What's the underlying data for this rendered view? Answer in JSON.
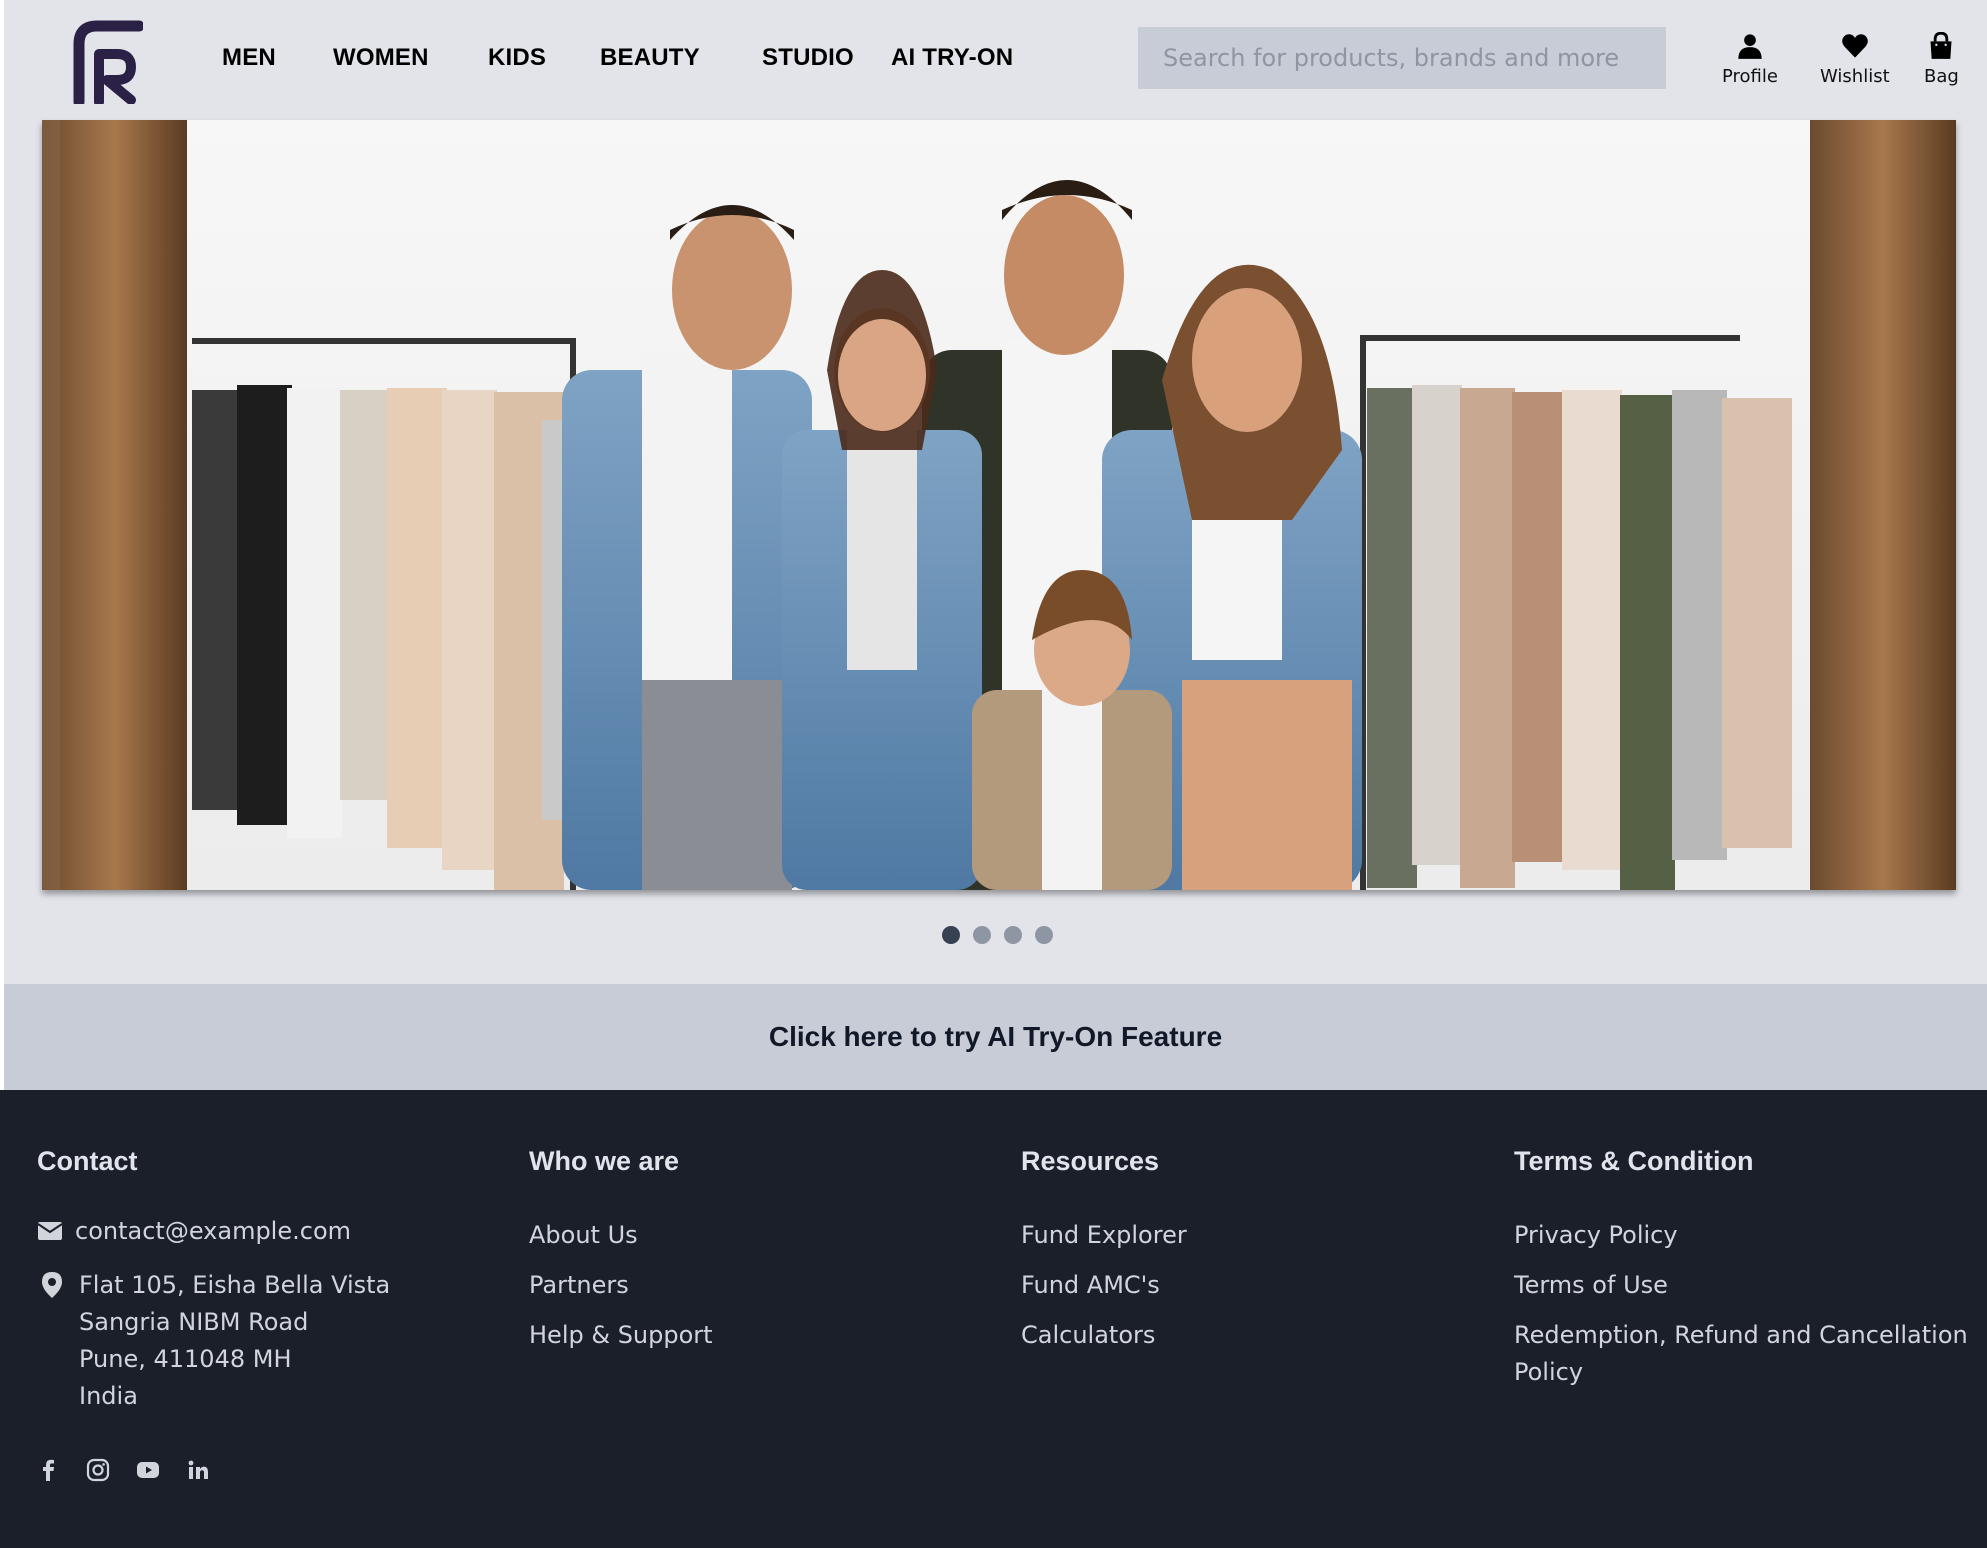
{
  "header": {
    "nav": [
      "MEN",
      "WOMEN",
      "KIDS",
      "BEAUTY",
      "STUDIO",
      "AI TRY-ON"
    ],
    "search_placeholder": "Search for products, brands and more",
    "icons": {
      "profile": "Profile",
      "wishlist": "Wishlist",
      "bag": "Bag"
    }
  },
  "hero": {
    "image": "hero-family-denim-photo",
    "slides": 4,
    "active_slide": 1
  },
  "cta": {
    "label": "Click here to try AI Try-On Feature"
  },
  "footer": {
    "contact": {
      "heading": "Contact",
      "email": "contact@example.com",
      "address": [
        "Flat 105, Eisha Bella Vista",
        "Sangria NIBM Road",
        "Pune, 411048 MH",
        "India"
      ]
    },
    "who": {
      "heading": "Who we are",
      "links": [
        "About Us",
        "Partners",
        "Help & Support"
      ]
    },
    "resources": {
      "heading": "Resources",
      "links": [
        "Fund Explorer",
        "Fund AMC's",
        "Calculators"
      ]
    },
    "terms": {
      "heading": "Terms & Condition",
      "links": [
        "Privacy Policy",
        "Terms of Use",
        "Redemption, Refund and Cancellation Policy"
      ]
    },
    "social": [
      "facebook-icon",
      "instagram-icon",
      "youtube-icon",
      "linkedin-icon"
    ]
  },
  "colors": {
    "header_bg": "#e2e4ea",
    "cta_bg": "#c7ccd6",
    "footer_bg": "#1a1f2a",
    "logo": "#2b2146"
  }
}
